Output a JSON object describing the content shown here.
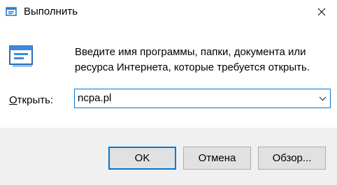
{
  "window": {
    "title": "Выполнить",
    "icon": "run-app-icon",
    "close_icon": "close-icon"
  },
  "description": {
    "line1": "Введите имя программы, папки, документа или",
    "line2": "ресурса Интернета, которые требуется открыть."
  },
  "open_field": {
    "label_mnemonic": "О",
    "label_rest": "ткрыть:",
    "value": "ncpa.pl",
    "dropdown_icon": "chevron-down-icon"
  },
  "buttons": {
    "ok": "OK",
    "cancel": "Отмена",
    "browse": "Обзор..."
  },
  "colors": {
    "accent": "#0078d7",
    "footer_bg": "#f0f0f0",
    "button_bg": "#e1e1e1"
  }
}
